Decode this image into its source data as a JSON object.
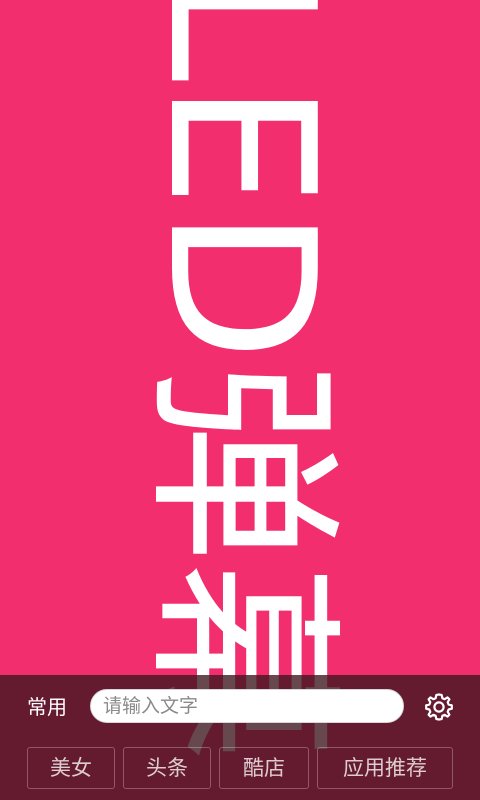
{
  "marquee": {
    "text": "LED弹幕"
  },
  "panel": {
    "common_label": "常用",
    "input": {
      "value": "",
      "placeholder": "请输入文字"
    },
    "settings_icon": "gear-icon",
    "chips": [
      {
        "label": "美女"
      },
      {
        "label": "头条"
      },
      {
        "label": "酷店"
      },
      {
        "label": "应用推荐"
      }
    ]
  },
  "colors": {
    "background": "#f22e6f",
    "text": "#ffffff",
    "panel": "#3c141e"
  }
}
